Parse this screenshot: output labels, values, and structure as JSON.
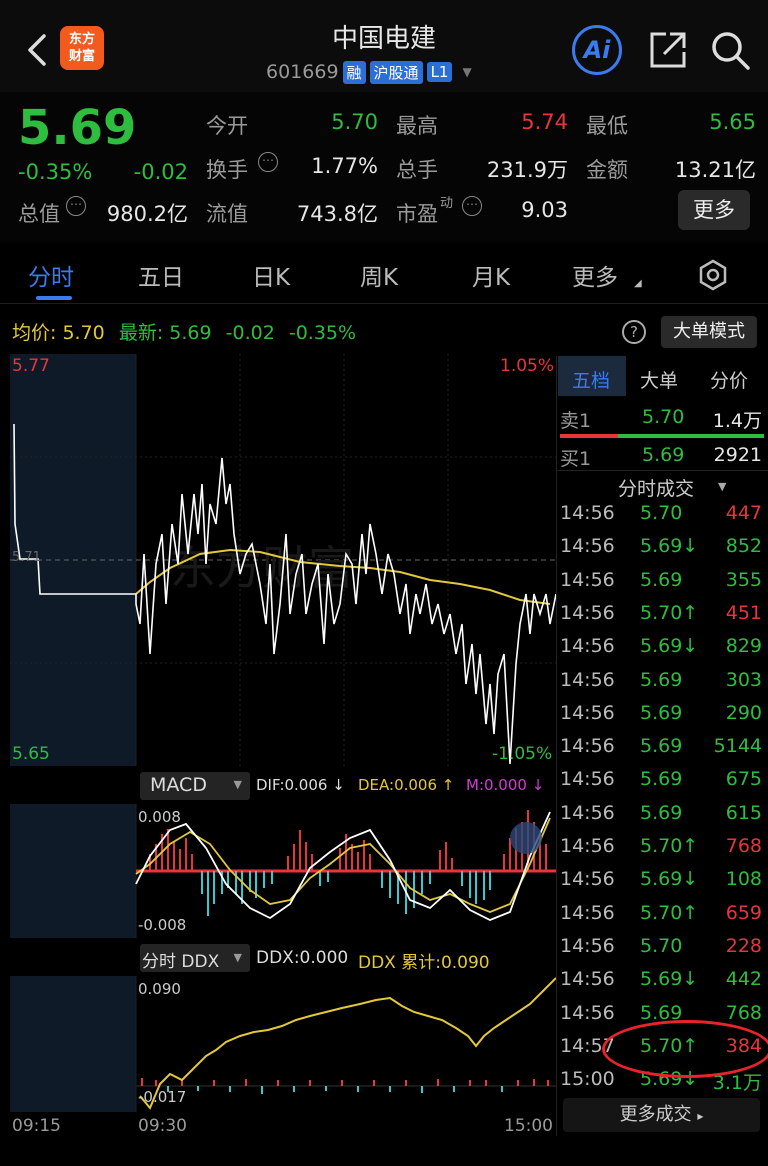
{
  "header": {
    "title": "中国电建",
    "code": "601669",
    "tags": [
      "融",
      "沪股通",
      "L1"
    ],
    "logo_line1": "东方",
    "logo_line2": "财富",
    "ai_label": "Ai"
  },
  "quote": {
    "price": "5.69",
    "change_pct": "-0.35%",
    "change": "-0.02",
    "labels": {
      "open": "今开",
      "high": "最高",
      "low": "最低",
      "turnover": "换手",
      "volume": "总手",
      "amount": "金额",
      "total_mv": "总值",
      "float_mv": "流值",
      "pe": "市盈",
      "pe_sup": "动"
    },
    "open": "5.70",
    "high": "5.74",
    "low": "5.65",
    "turnover": "1.77%",
    "volume": "231.9万",
    "amount": "13.21亿",
    "total_mv": "980.2亿",
    "float_mv": "743.8亿",
    "pe": "9.03",
    "more_label": "更多"
  },
  "tabs": [
    "分时",
    "五日",
    "日K",
    "周K",
    "月K",
    "更多"
  ],
  "info": {
    "avg_label": "均价:",
    "avg": "5.70",
    "latest_label": "最新:",
    "latest": "5.69",
    "chg": "-0.02",
    "pct": "-0.35%",
    "help": "?",
    "bigmode": "大单模式"
  },
  "chart": {
    "top_price": "5.77",
    "top_pct": "1.05%",
    "bottom_price": "5.65",
    "bottom_pct": "-1.05%",
    "mid_price": "5.71",
    "watermark": "东方财富",
    "macd_label": "MACD",
    "dif": "DIF:0.006 ↓",
    "dea": "DEA:0.006 ↑",
    "m": "M:0.000 ↓",
    "macd_top": "0.008",
    "macd_bottom": "-0.008",
    "ddx_label": "分时 DDX",
    "ddx": "DDX:0.000",
    "ddx_cum": "DDX 累计:0.090",
    "ddx_top": "0.090",
    "ddx_bottom": "-0.017",
    "time_start": "09:15",
    "time_mid": "09:30",
    "time_end": "15:00"
  },
  "right_panel": {
    "tabs": [
      "五档",
      "大单",
      "分价"
    ],
    "sell1_label": "卖1",
    "sell1_price": "5.70",
    "sell1_vol": "1.4万",
    "buy1_label": "买1",
    "buy1_price": "5.69",
    "buy1_vol": "2921",
    "trades_title": "分时成交",
    "trades": [
      {
        "time": "14:56",
        "price": "5.70",
        "vol": "447",
        "arrow": "",
        "vcolor": "red"
      },
      {
        "time": "14:56",
        "price": "5.69↓",
        "vol": "852",
        "arrow": "",
        "vcolor": "green"
      },
      {
        "time": "14:56",
        "price": "5.69",
        "vol": "355",
        "arrow": "",
        "vcolor": "green"
      },
      {
        "time": "14:56",
        "price": "5.70↑",
        "vol": "451",
        "arrow": "",
        "vcolor": "red"
      },
      {
        "time": "14:56",
        "price": "5.69↓",
        "vol": "829",
        "arrow": "",
        "vcolor": "green"
      },
      {
        "time": "14:56",
        "price": "5.69",
        "vol": "303",
        "arrow": "",
        "vcolor": "green"
      },
      {
        "time": "14:56",
        "price": "5.69",
        "vol": "290",
        "arrow": "",
        "vcolor": "green"
      },
      {
        "time": "14:56",
        "price": "5.69",
        "vol": "5144",
        "arrow": "",
        "vcolor": "green"
      },
      {
        "time": "14:56",
        "price": "5.69",
        "vol": "675",
        "arrow": "",
        "vcolor": "green"
      },
      {
        "time": "14:56",
        "price": "5.69",
        "vol": "615",
        "arrow": "",
        "vcolor": "green"
      },
      {
        "time": "14:56",
        "price": "5.70↑",
        "vol": "768",
        "arrow": "",
        "vcolor": "red"
      },
      {
        "time": "14:56",
        "price": "5.69↓",
        "vol": "108",
        "arrow": "",
        "vcolor": "green"
      },
      {
        "time": "14:56",
        "price": "5.70↑",
        "vol": "659",
        "arrow": "",
        "vcolor": "red"
      },
      {
        "time": "14:56",
        "price": "5.70",
        "vol": "228",
        "arrow": "",
        "vcolor": "red"
      },
      {
        "time": "14:56",
        "price": "5.69↓",
        "vol": "442",
        "arrow": "",
        "vcolor": "green"
      },
      {
        "time": "14:56",
        "price": "5.69",
        "vol": "768",
        "arrow": "",
        "vcolor": "green"
      },
      {
        "time": "14:57",
        "price": "5.70↑",
        "vol": "384",
        "arrow": "",
        "vcolor": "red"
      },
      {
        "time": "15:00",
        "price": "5.69↓",
        "vol": "3.1万",
        "arrow": "",
        "vcolor": "green"
      }
    ],
    "more_trades": "更多成交"
  },
  "colors": {
    "up": "#e8353b",
    "down": "#2ebd3f",
    "avg": "#e3c83a",
    "accent": "#3b7bf0",
    "bg": "#000000"
  }
}
